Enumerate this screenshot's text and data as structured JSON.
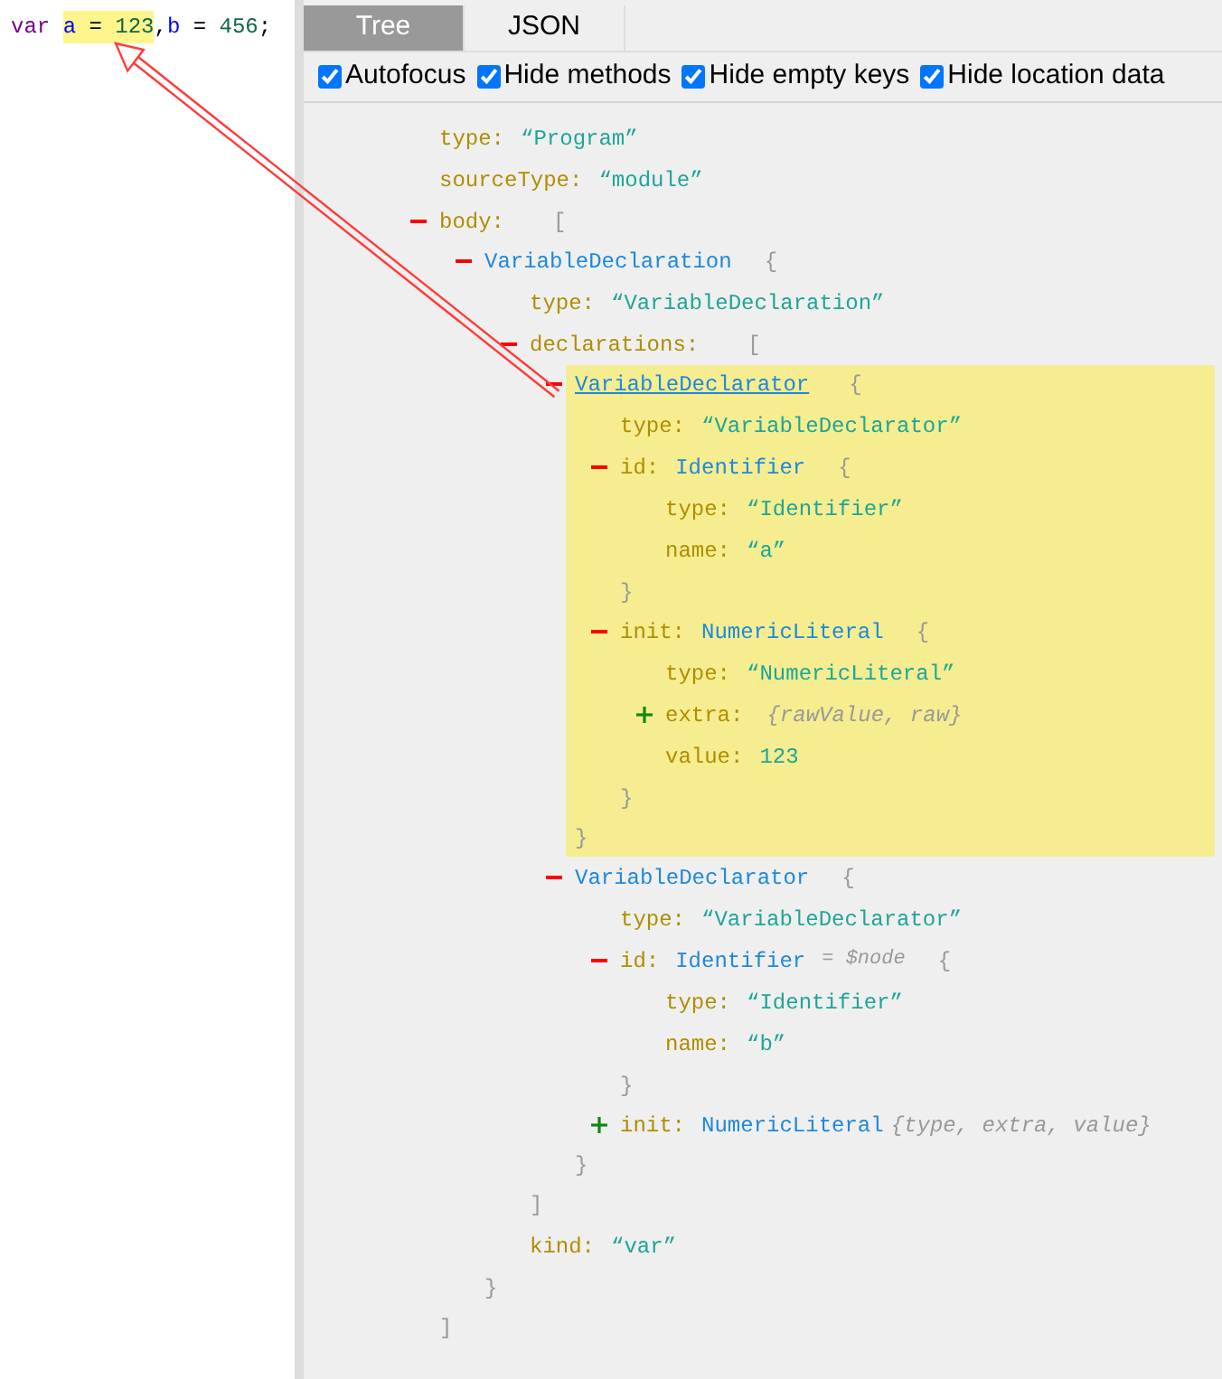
{
  "editor": {
    "tokens": [
      {
        "text": "var",
        "kind": "keyword",
        "highlighted": false,
        "space_after": true
      },
      {
        "text": "a",
        "kind": "variable",
        "highlighted": true,
        "space_after": true
      },
      {
        "text": "=",
        "kind": "operator",
        "highlighted": true,
        "space_after": true
      },
      {
        "text": "123",
        "kind": "number",
        "highlighted": true,
        "space_after": false
      },
      {
        "text": ",",
        "kind": "punctuation",
        "highlighted": false,
        "space_after": false
      },
      {
        "text": "b",
        "kind": "variable",
        "highlighted": false,
        "space_after": true
      },
      {
        "text": "=",
        "kind": "operator",
        "highlighted": false,
        "space_after": true
      },
      {
        "text": "456",
        "kind": "number",
        "highlighted": false,
        "space_after": false
      },
      {
        "text": ";",
        "kind": "punctuation",
        "highlighted": false,
        "space_after": false
      }
    ]
  },
  "tabs": [
    {
      "label": "Tree",
      "selected": true
    },
    {
      "label": "JSON",
      "selected": false
    }
  ],
  "options": [
    {
      "label": "Autofocus",
      "checked": true
    },
    {
      "label": "Hide methods",
      "checked": true
    },
    {
      "label": "Hide empty keys",
      "checked": true
    },
    {
      "label": "Hide location data",
      "checked": true
    }
  ],
  "tree": [
    {
      "kind": "field",
      "key": "type:",
      "value": "“Program”"
    },
    {
      "kind": "field",
      "key": "sourceType:",
      "value": "“module”"
    },
    {
      "kind": "node",
      "key": "body:",
      "open": "[",
      "close": "]",
      "expanded": true,
      "selected": false,
      "children": [
        {
          "kind": "node",
          "type_name": "VariableDeclaration",
          "open": "{",
          "close": "}",
          "expanded": true,
          "selected": false,
          "children": [
            {
              "kind": "field",
              "key": "type:",
              "value": "“VariableDeclaration”"
            },
            {
              "kind": "node",
              "key": "declarations:",
              "open": "[",
              "close": "]",
              "expanded": true,
              "selected": false,
              "children": [
                {
                  "kind": "node",
                  "type_name": "VariableDeclarator",
                  "open": "{",
                  "close": "}",
                  "expanded": true,
                  "selected": true,
                  "children": [
                    {
                      "kind": "field",
                      "key": "type:",
                      "value": "“VariableDeclarator”"
                    },
                    {
                      "kind": "node",
                      "key": "id:",
                      "type_name": "Identifier",
                      "open": "{",
                      "close": "}",
                      "expanded": true,
                      "selected": false,
                      "children": [
                        {
                          "kind": "field",
                          "key": "type:",
                          "value": "“Identifier”"
                        },
                        {
                          "kind": "field",
                          "key": "name:",
                          "value": "“a”"
                        }
                      ]
                    },
                    {
                      "kind": "node",
                      "key": "init:",
                      "type_name": "NumericLiteral",
                      "open": "{",
                      "close": "}",
                      "expanded": true,
                      "selected": false,
                      "children": [
                        {
                          "kind": "field",
                          "key": "type:",
                          "value": "“NumericLiteral”"
                        },
                        {
                          "kind": "node",
                          "key": "extra:",
                          "expanded": false,
                          "selected": false,
                          "summary": "{rawValue, raw}"
                        },
                        {
                          "kind": "field",
                          "key": "value:",
                          "value": "123"
                        }
                      ]
                    }
                  ]
                },
                {
                  "kind": "node",
                  "type_name": "VariableDeclarator",
                  "open": "{",
                  "close": "}",
                  "expanded": true,
                  "selected": false,
                  "children": [
                    {
                      "kind": "field",
                      "key": "type:",
                      "value": "“VariableDeclarator”"
                    },
                    {
                      "kind": "node",
                      "key": "id:",
                      "type_name": "Identifier",
                      "hint": "= $node",
                      "open": "{",
                      "close": "}",
                      "expanded": true,
                      "selected": false,
                      "children": [
                        {
                          "kind": "field",
                          "key": "type:",
                          "value": "“Identifier”"
                        },
                        {
                          "kind": "field",
                          "key": "name:",
                          "value": "“b”"
                        }
                      ]
                    },
                    {
                      "kind": "node",
                      "key": "init:",
                      "type_name": "NumericLiteral",
                      "expanded": false,
                      "selected": false,
                      "summary": "{type, extra, value}"
                    }
                  ]
                }
              ]
            },
            {
              "kind": "field",
              "key": "kind:",
              "value": "“var”"
            }
          ]
        }
      ]
    }
  ]
}
